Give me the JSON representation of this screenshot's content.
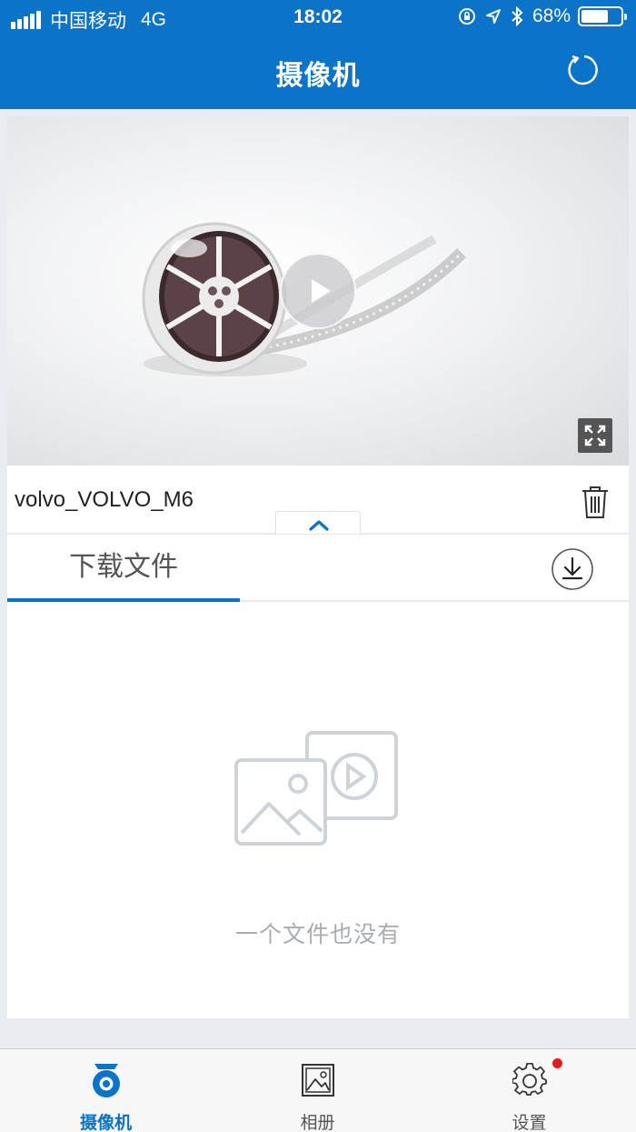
{
  "status_bar": {
    "carrier": "中国移动",
    "network": "4G",
    "time": "18:02",
    "battery_percent": "68%",
    "battery_level": 0.68
  },
  "header": {
    "title": "摄像机",
    "refresh_icon": "refresh-icon"
  },
  "player": {
    "play_icon": "play-icon",
    "fullscreen_icon": "fullscreen-icon"
  },
  "device": {
    "name": "volvo_VOLVO_M6",
    "delete_icon": "trash-icon",
    "collapse_icon": "chevron-up-icon"
  },
  "tabs": {
    "download_label": "下载文件",
    "download_icon": "download-icon"
  },
  "empty_state": {
    "message": "一个文件也没有",
    "icon": "media-placeholder-icon"
  },
  "bottom_nav": {
    "items": [
      {
        "label": "摄像机",
        "icon": "camera-icon",
        "active": true
      },
      {
        "label": "相册",
        "icon": "album-icon",
        "active": false
      },
      {
        "label": "设置",
        "icon": "gear-icon",
        "active": false,
        "badge": true
      }
    ]
  },
  "colors": {
    "accent": "#0b73c8",
    "badge": "#e01d1d",
    "background": "#e9edf1"
  }
}
